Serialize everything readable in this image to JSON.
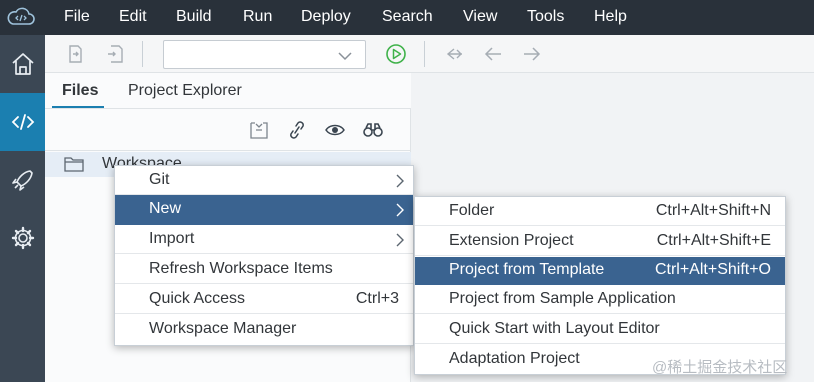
{
  "menubar": {
    "items": [
      "File",
      "Edit",
      "Build",
      "Run",
      "Deploy",
      "Search",
      "View",
      "Tools",
      "Help"
    ]
  },
  "leftnav": {
    "items": [
      {
        "icon": "home-icon"
      },
      {
        "icon": "code-icon",
        "active": true
      },
      {
        "icon": "rocket-icon"
      },
      {
        "icon": "gear-icon"
      }
    ]
  },
  "toolbar": {
    "run_config_value": "",
    "icons": [
      "import-icon",
      "export-icon",
      "run-icon",
      "back-step-icon",
      "back-icon",
      "forward-icon"
    ]
  },
  "files_pane": {
    "tabs": [
      "Files",
      "Project Explorer"
    ],
    "active_tab": "Files",
    "tree_icons": [
      "collapse-all-icon",
      "link-icon",
      "show-hidden-icon",
      "search-binoculars-icon"
    ],
    "tree": [
      {
        "label": "Workspace",
        "icon": "folder-icon"
      }
    ]
  },
  "context_menu": {
    "items": [
      {
        "label": "Git",
        "submenu": true
      },
      {
        "label": "New",
        "submenu": true,
        "selected": true
      },
      {
        "label": "Import",
        "submenu": true
      },
      {
        "label": "Refresh Workspace Items"
      },
      {
        "label": "Quick Access",
        "shortcut": "Ctrl+3"
      },
      {
        "label": "Workspace Manager"
      }
    ]
  },
  "submenu_new": {
    "items": [
      {
        "label": "Folder",
        "shortcut": "Ctrl+Alt+Shift+N"
      },
      {
        "label": "Extension Project",
        "shortcut": "Ctrl+Alt+Shift+E"
      },
      {
        "label": "Project from Template",
        "shortcut": "Ctrl+Alt+Shift+O",
        "selected": true
      },
      {
        "label": "Project from Sample Application"
      },
      {
        "label": "Quick Start with Layout Editor"
      },
      {
        "label": "Adaptation Project"
      }
    ]
  },
  "watermark": "@稀土掘金技术社区",
  "colors": {
    "menubar_bg": "#29313a",
    "leftnav_bg": "#3b4754",
    "active_nav": "#1b7fb0",
    "selection": "#3a6390",
    "run_green": "#3fb24a"
  }
}
